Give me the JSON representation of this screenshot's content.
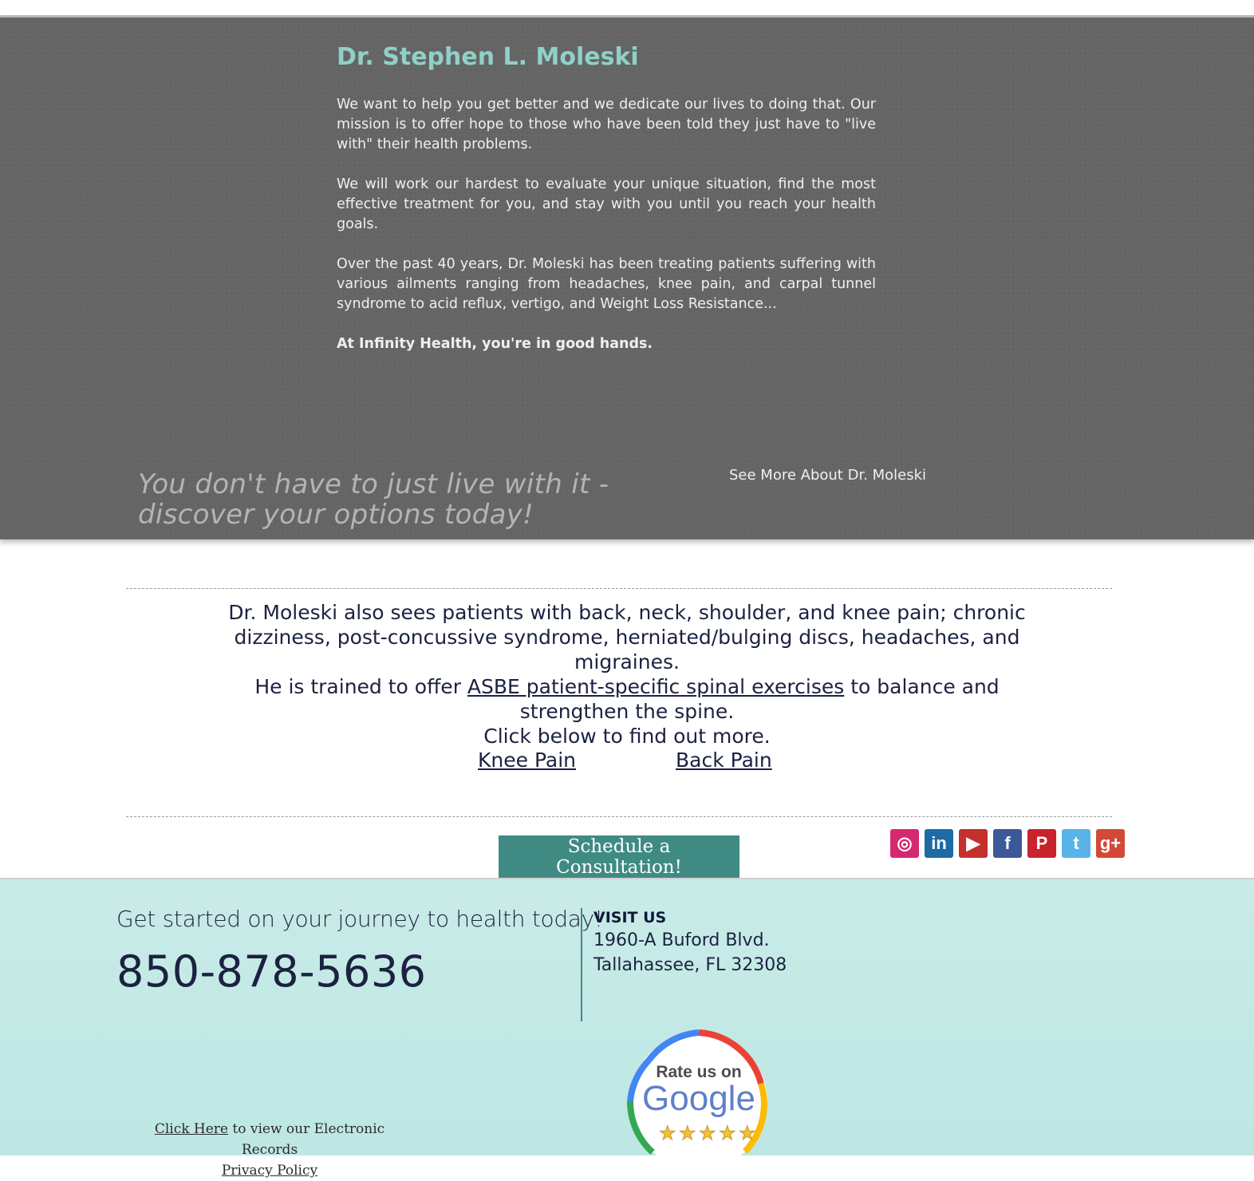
{
  "hero": {
    "title": "Dr. Stephen L. Moleski",
    "paragraphs": [
      "We want to help you get better and we dedicate our lives to doing that. Our mission is to offer hope to those who have been told they just have to \"live with\" their health problems.",
      "We will work our hardest to evaluate your unique situation, find the most effective treatment for you, and stay with you until you reach your health goals.",
      "Over the past 40 years, Dr. Moleski has been treating patients suffering with various ailments ranging from headaches, knee pain, and carpal tunnel syndrome to acid reflux, vertigo, and Weight Loss Resistance...",
      "At Infinity Health, you're in good hands."
    ],
    "tagline": "You don't have to just live with it - discover your options today!",
    "see_more_link": "See More About Dr. Moleski"
  },
  "middle": {
    "line1": "Dr. Moleski also sees patients with back, neck, shoulder, and knee pain; chronic dizziness, post-concussive syndrome, herniated/bulging discs, headaches, and migraines.",
    "line2_before": "He is trained to offer ",
    "asbe_link": "ASBE patient-specific spinal exercises",
    "line2_after": " to balance and strengthen the spine.",
    "line3": "Click below to find out more.",
    "knee_link": "Knee Pain",
    "back_link": "Back Pain"
  },
  "schedule_button": "Schedule a Consultation!",
  "social": [
    {
      "name": "instagram-icon",
      "glyph": "◎",
      "color": "#d6286f"
    },
    {
      "name": "linkedin-icon",
      "glyph": "in",
      "color": "#1d6aa5"
    },
    {
      "name": "youtube-icon",
      "glyph": "▶",
      "color": "#c4302b"
    },
    {
      "name": "facebook-icon",
      "glyph": "f",
      "color": "#3b5998"
    },
    {
      "name": "pinterest-icon",
      "glyph": "P",
      "color": "#c8232c"
    },
    {
      "name": "twitter-icon",
      "glyph": "t",
      "color": "#5ab3e8"
    },
    {
      "name": "google-plus-icon",
      "glyph": "g+",
      "color": "#d34836"
    }
  ],
  "footer": {
    "journey": "Get started on your journey to health today!",
    "phone": "850-878-5636",
    "visit_label": "VISIT US",
    "address_line1": "1960-A Buford Blvd.",
    "address_line2": "Tallahassee, FL 32308",
    "records_link": "Click Here",
    "records_text": " to view our Electronic Records",
    "privacy_link": "Privacy Policy",
    "badge_line1": "Rate us on",
    "badge_line2": "Google"
  }
}
